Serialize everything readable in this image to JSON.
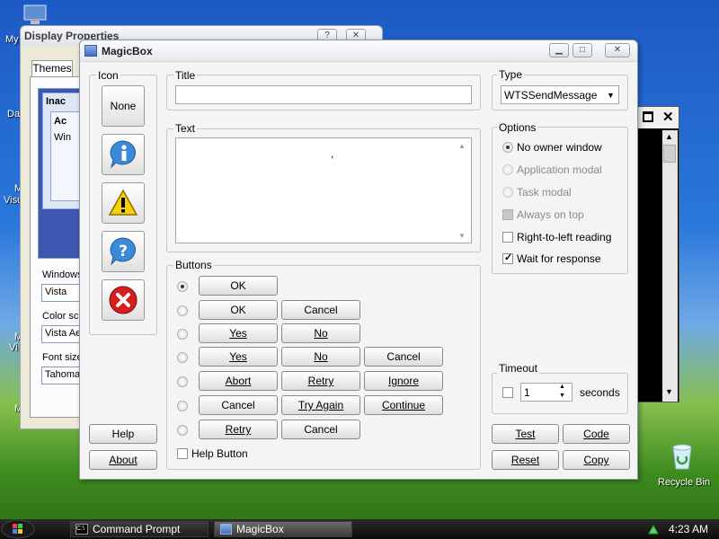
{
  "desktop": {
    "icons": {
      "my_computer_partial": "My",
      "da_partial": "Da",
      "m_partial_1": "M",
      "visu_partial": "Visu",
      "m_partial_2": "M",
      "vi_partial": "Vi",
      "m_partial_3": "M",
      "recycle_bin": "Recycle Bin"
    }
  },
  "display_properties": {
    "title": "Display Properties",
    "tab_themes": "Themes",
    "preview_inactive": "Inac",
    "preview_active": "Ac",
    "preview_window": "Win",
    "windows_label": "Windows",
    "windows_value": "Vista",
    "color_scheme_label": "Color sch",
    "color_scheme_value": "Vista Ae",
    "font_size_label": "Font size",
    "font_size_value": "Tahoma"
  },
  "magicbox": {
    "title": "MagicBox",
    "icon_group": {
      "label": "Icon",
      "none_label": "None",
      "icons": [
        "info-icon",
        "warning-icon",
        "question-icon",
        "error-icon"
      ]
    },
    "title_group": {
      "label": "Title",
      "value": ""
    },
    "text_group": {
      "label": "Text",
      "value": ","
    },
    "type_group": {
      "label": "Type",
      "value": "WTSSendMessage"
    },
    "options": {
      "label": "Options",
      "no_owner_window": "No owner window",
      "application_modal": "Application modal",
      "task_modal": "Task modal",
      "always_on_top": "Always on top",
      "right_to_left": "Right-to-left reading",
      "wait_for_response": "Wait for response"
    },
    "buttons_group": {
      "label": "Buttons",
      "row1": [
        "OK"
      ],
      "row2": [
        "OK",
        "Cancel"
      ],
      "row3": [
        "Yes",
        "No"
      ],
      "row4": [
        "Yes",
        "No",
        "Cancel"
      ],
      "row5": [
        "Abort",
        "Retry",
        "Ignore"
      ],
      "row6": [
        "Cancel",
        "Try Again",
        "Continue"
      ],
      "row7": [
        "Retry",
        "Cancel"
      ],
      "help_button": "Help Button"
    },
    "timeout": {
      "label": "Timeout",
      "value": "1",
      "unit": "seconds"
    },
    "actions": {
      "help": "Help",
      "about": "About",
      "test": "Test",
      "code": "Code",
      "reset": "Reset",
      "copy": "Copy"
    }
  },
  "taskbar": {
    "items": [
      "Command Prompt",
      "MagicBox"
    ],
    "clock": "4:23 AM"
  }
}
